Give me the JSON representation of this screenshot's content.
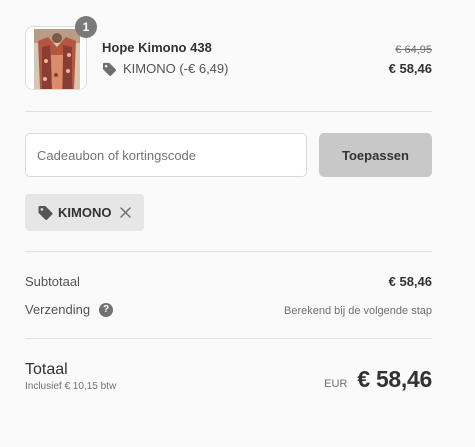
{
  "line_item": {
    "quantity": "1",
    "name": "Hope Kimono 438",
    "discount_text": "KIMONO (-€ 6,49)",
    "original_price": "€ 64,95",
    "price": "€ 58,46"
  },
  "discount_form": {
    "placeholder": "Cadeaubon of kortingscode",
    "apply_label": "Toepassen",
    "applied_code": "KIMONO"
  },
  "summary": {
    "subtotal_label": "Subtotaal",
    "subtotal_value": "€ 58,46",
    "shipping_label": "Verzending",
    "shipping_help": "?",
    "shipping_value": "Berekend bij de volgende stap",
    "total_label": "Totaal",
    "tax_note": "Inclusief € 10,15 btw",
    "currency": "EUR",
    "total_value": "€ 58,46"
  },
  "colors": {
    "background": "#fafafa",
    "button_bg": "#c8c8c8",
    "chip_bg": "#e6e6e6",
    "badge_bg": "#7a7a7a"
  },
  "icons": {
    "discount": "tag-icon",
    "remove": "close-icon",
    "help": "question-circle-icon"
  }
}
